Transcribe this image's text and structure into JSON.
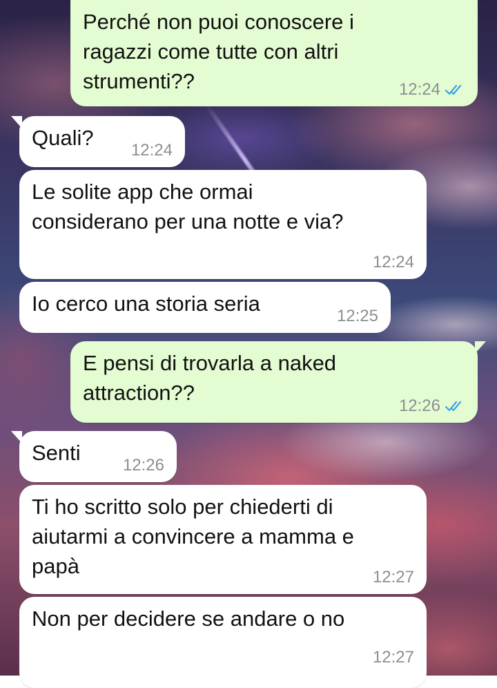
{
  "chat": {
    "messages": [
      {
        "direction": "out",
        "text": "Perché non puoi conoscere i\nragazzi come tutte con altri\nstrumenti??",
        "time": "12:24",
        "status": "read"
      },
      {
        "direction": "in",
        "text": "Quali?",
        "time": "12:24"
      },
      {
        "direction": "in",
        "text": "Le solite app che ormai\nconsiderano per una notte e via?",
        "time": "12:24"
      },
      {
        "direction": "in",
        "text": "Io cerco una storia seria",
        "time": "12:25"
      },
      {
        "direction": "out",
        "text": "E pensi di trovarla a naked\nattraction??",
        "time": "12:26",
        "status": "read"
      },
      {
        "direction": "in",
        "text": "Senti",
        "time": "12:26"
      },
      {
        "direction": "in",
        "text": "Ti ho scritto solo per chiederti di\naiutarmi a convincere a mamma e\npapà",
        "time": "12:27"
      },
      {
        "direction": "in",
        "text": "Non per decidere se andare o no",
        "time": "12:27"
      }
    ]
  },
  "icons": {
    "read_receipt": "double-check-icon"
  },
  "colors": {
    "incoming_bubble": "#ffffff",
    "outgoing_bubble": "#e4fcd2",
    "timestamp": "#8a8f93",
    "read_ticks": "#3aa3e3"
  }
}
